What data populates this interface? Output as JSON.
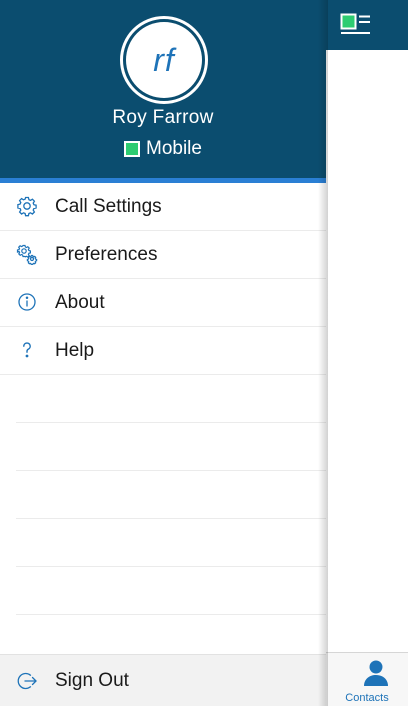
{
  "profile": {
    "initials": "rf",
    "name": "Roy Farrow",
    "status": "Mobile",
    "status_color": "#2ecc71"
  },
  "menu": {
    "items": [
      {
        "label": "Call Settings",
        "icon": "gear-icon"
      },
      {
        "label": "Preferences",
        "icon": "gears-icon"
      },
      {
        "label": "About",
        "icon": "info-icon"
      },
      {
        "label": "Help",
        "icon": "question-icon"
      }
    ],
    "sign_out": {
      "label": "Sign Out",
      "icon": "sign-out-icon"
    }
  },
  "tabbar": {
    "contacts": {
      "label": "Contacts",
      "icon": "person-icon"
    }
  },
  "colors": {
    "header": "#0b4d6f",
    "accent": "#1e73b8",
    "underline": "#2a7fd4"
  }
}
